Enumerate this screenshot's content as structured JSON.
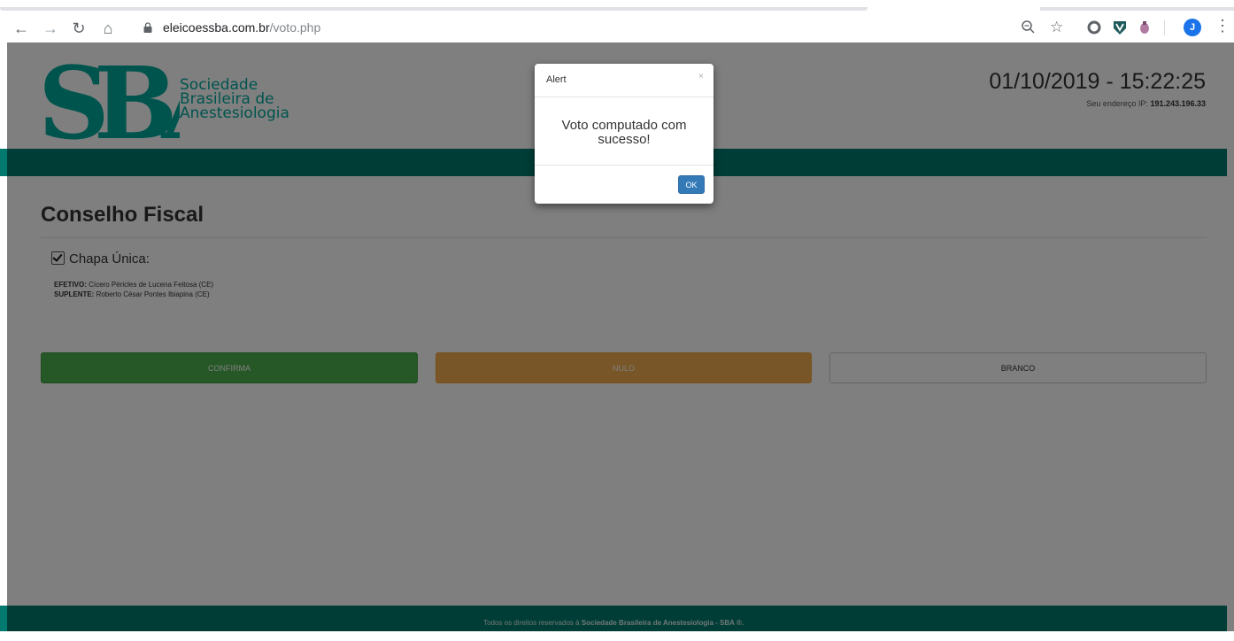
{
  "browser": {
    "url_domain": "eleicoessba.com.br",
    "url_path": "/voto.php",
    "profile_initial": "J",
    "back_icon": "arrow-left-icon",
    "forward_icon": "arrow-right-icon",
    "reload_icon": "reload-icon",
    "home_icon": "home-icon"
  },
  "header": {
    "logo_line1": "Sociedade",
    "logo_line2": "Brasileira de",
    "logo_line3": "Anestesiologia",
    "datetime": "01/10/2019 - 15:22:25",
    "ip_label": "Seu endereço IP:",
    "ip_value": "191.243.196.33"
  },
  "section": {
    "title": "Conselho Fiscal",
    "option_label": "Chapa Única:",
    "option_checked": true,
    "efetivo_label": "EFETIVO:",
    "efetivo_name": "Cícero Péricles de Lucena Feitosa (CE)",
    "suplente_label": "SUPLENTE:",
    "suplente_name": "Roberto César Pontes Ibiapina (CE)"
  },
  "buttons": {
    "confirma": "CONFIRMA",
    "nulo": "NULO",
    "branco": "BRANCO"
  },
  "footer": {
    "prefix": "Todos os direitos reservados à",
    "org": "Sociedade Brasileira de Anestesiologia - SBA ®."
  },
  "modal": {
    "title": "Alert",
    "close": "×",
    "message": "Voto computado com sucesso!",
    "ok": "OK"
  },
  "colors": {
    "brand_teal": "#007a6e",
    "logo_teal": "#00a99d",
    "confirm_green": "#4cae4c",
    "nulo_orange": "#f0ad4e",
    "ok_blue": "#337ab7"
  }
}
